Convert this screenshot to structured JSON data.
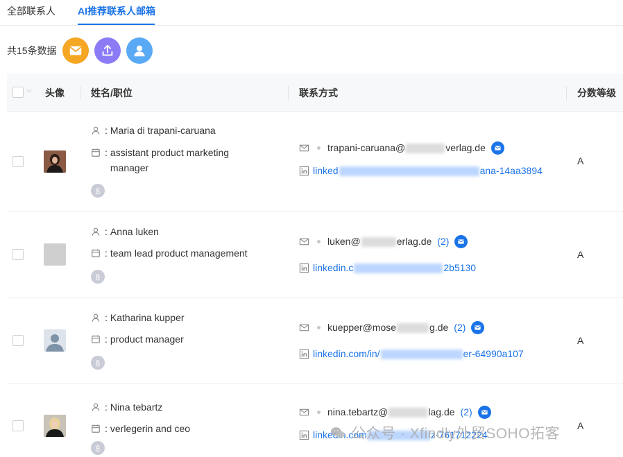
{
  "tabs": {
    "all_contacts": "全部联系人",
    "ai_recommended": "AI推荐联系人邮箱"
  },
  "toolbar": {
    "count_text": "共15条数据",
    "mail_color": "#f5a623",
    "export_color": "#8b7cf6",
    "contact_color": "#5aa9f5"
  },
  "table": {
    "headers": {
      "avatar": "头像",
      "name_title": "姓名/职位",
      "contact": "联系方式",
      "grade": "分数等级"
    },
    "rows": [
      {
        "name": "Maria di trapani-caruana",
        "title": "assistant product marketing manager",
        "email_prefix": "trapani-caruana@",
        "email_suffix": "verlag.de",
        "email_count": "",
        "linkedin_prefix": "linked",
        "linkedin_suffix": "ana-14aa3894",
        "grade": "A"
      },
      {
        "name": "Anna luken",
        "title": "team lead product management",
        "email_prefix": "luken@",
        "email_suffix": "erlag.de",
        "email_count": "(2)",
        "linkedin_prefix": "linkedin.c",
        "linkedin_suffix": "2b5130",
        "grade": "A"
      },
      {
        "name": "Katharina kupper",
        "title": "product manager",
        "email_prefix": "kuepper@mose",
        "email_suffix": "g.de",
        "email_count": "(2)",
        "linkedin_prefix": "linkedin.com/in/",
        "linkedin_suffix": "er-64990a107",
        "grade": "A"
      },
      {
        "name": "Nina tebartz",
        "title": "verlegerin and ceo",
        "email_prefix": "nina.tebartz@",
        "email_suffix": "lag.de",
        "email_count": "(2)",
        "linkedin_prefix": "linkedin.com",
        "linkedin_suffix": "z-761712224",
        "grade": "A"
      }
    ]
  },
  "watermark": "公众号 · Xfindly外贸SOHO拓客",
  "colors": {
    "accent": "#1a73e8",
    "border": "#ececec",
    "header_bg": "#f7f8fa"
  }
}
